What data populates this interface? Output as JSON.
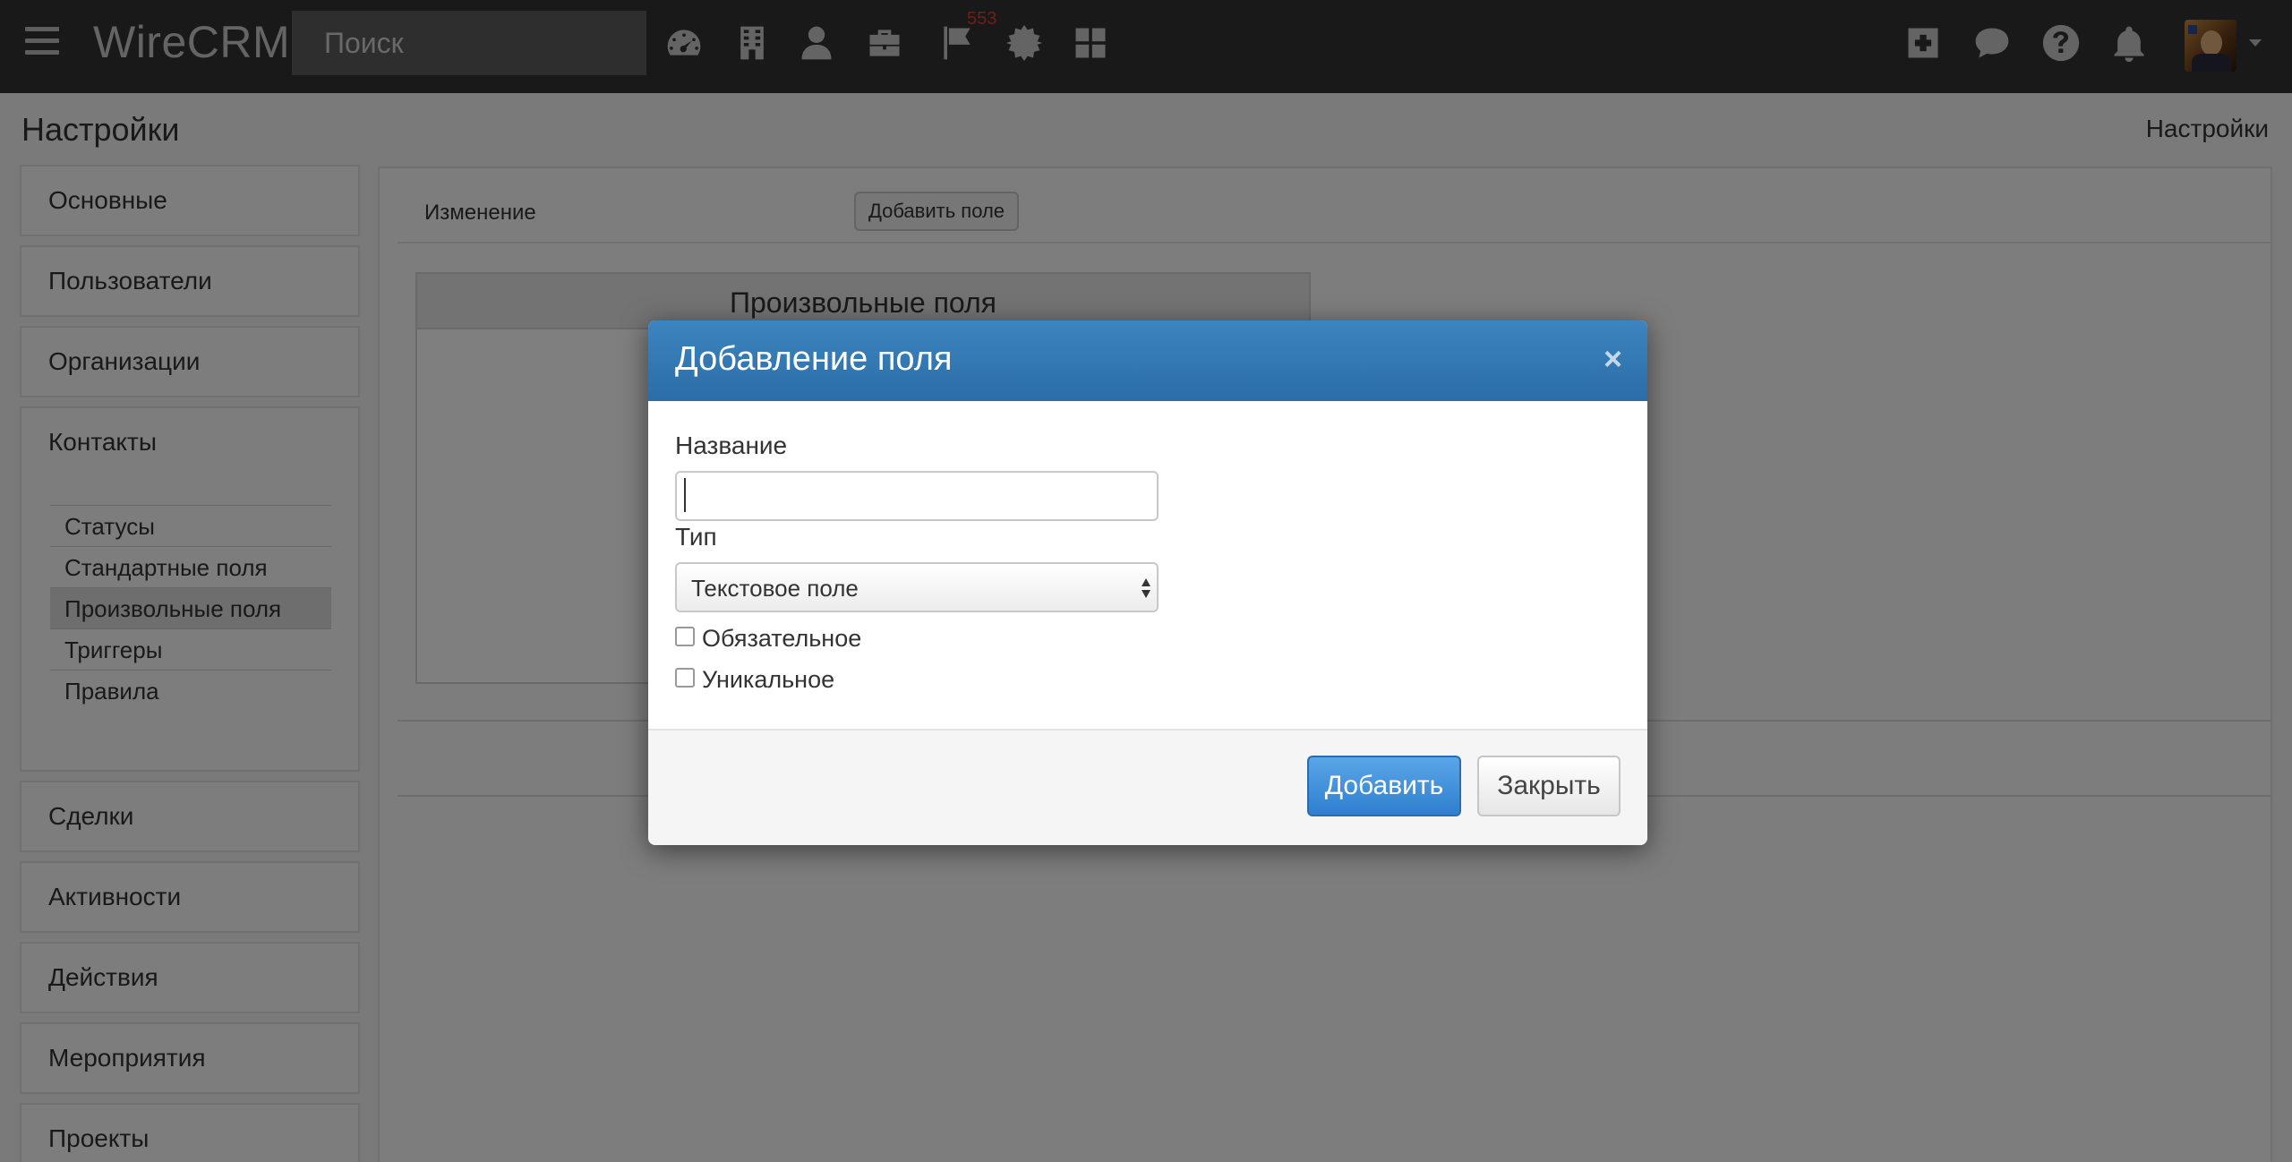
{
  "app": {
    "brand": "WireCRM"
  },
  "navbar": {
    "search_placeholder": "Поиск",
    "icons": [
      "dashboard-icon",
      "building-icon",
      "user-icon",
      "briefcase-icon",
      "flag-icon",
      "gear-icon",
      "apps-grid-icon",
      "plus-square-icon",
      "chat-icon",
      "help-icon",
      "bell-icon"
    ],
    "notification_count": "553"
  },
  "page": {
    "title": "Настройки",
    "breadcrumb": "Настройки"
  },
  "sidebar": {
    "items": [
      {
        "label": "Основные"
      },
      {
        "label": "Пользователи"
      },
      {
        "label": "Организации"
      },
      {
        "label": "Контакты"
      },
      {
        "label": "Сделки"
      },
      {
        "label": "Активности"
      },
      {
        "label": "Действия"
      },
      {
        "label": "Мероприятия"
      },
      {
        "label": "Проекты"
      }
    ],
    "contacts_subitems": [
      {
        "label": "Статусы"
      },
      {
        "label": "Стандартные поля"
      },
      {
        "label": "Произвольные поля",
        "active": true
      },
      {
        "label": "Триггеры"
      },
      {
        "label": "Правила"
      }
    ]
  },
  "content": {
    "toolbar_label": "Изменение",
    "add_field_button": "Добавить поле",
    "table_title": "Произвольные поля"
  },
  "modal": {
    "title": "Добавление поля",
    "close_symbol": "×",
    "name_label": "Название",
    "name_value": "",
    "type_label": "Тип",
    "type_selected": "Текстовое поле",
    "required_label": "Обязательное",
    "required_checked": false,
    "unique_label": "Уникальное",
    "unique_checked": false,
    "add_button": "Добавить",
    "close_button": "Закрыть"
  },
  "colors": {
    "navbar_bg": "#333333",
    "modal_header": "#2f74b0",
    "primary_button": "#3d8bd6",
    "badge": "#e53935"
  }
}
